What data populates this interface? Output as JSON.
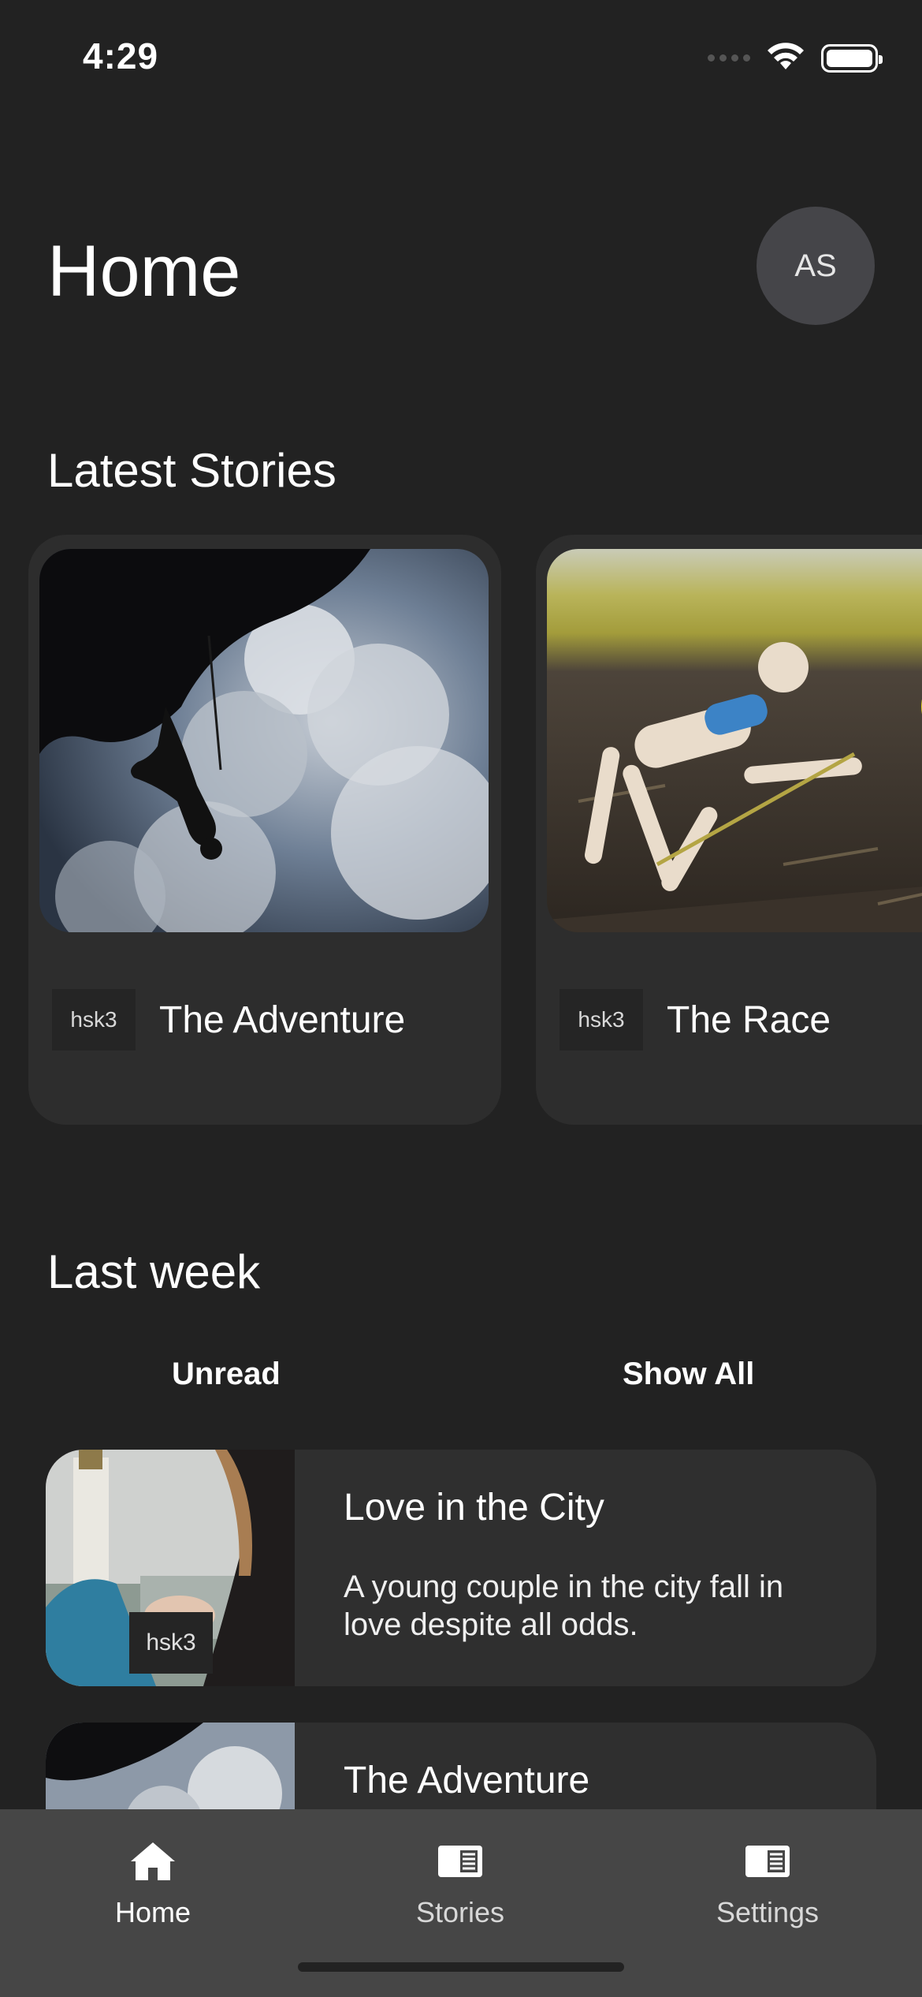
{
  "status_bar": {
    "time": "4:29"
  },
  "header": {
    "title": "Home",
    "avatar_initials": "AS"
  },
  "latest": {
    "title": "Latest Stories",
    "cards": [
      {
        "tag": "hsk3",
        "title": "The Adventure"
      },
      {
        "tag": "hsk3",
        "title": "The Race"
      }
    ]
  },
  "last_week": {
    "title": "Last week",
    "filters": {
      "unread": "Unread",
      "show_all": "Show All"
    },
    "items": [
      {
        "tag": "hsk3",
        "title": "Love in the City",
        "description": "A young couple in the city fall in love despite all odds."
      },
      {
        "title": "The Adventure"
      }
    ]
  },
  "tabs": [
    {
      "label": "Home",
      "icon": "home-icon"
    },
    {
      "label": "Stories",
      "icon": "stories-icon"
    },
    {
      "label": "Settings",
      "icon": "settings-icon"
    }
  ]
}
